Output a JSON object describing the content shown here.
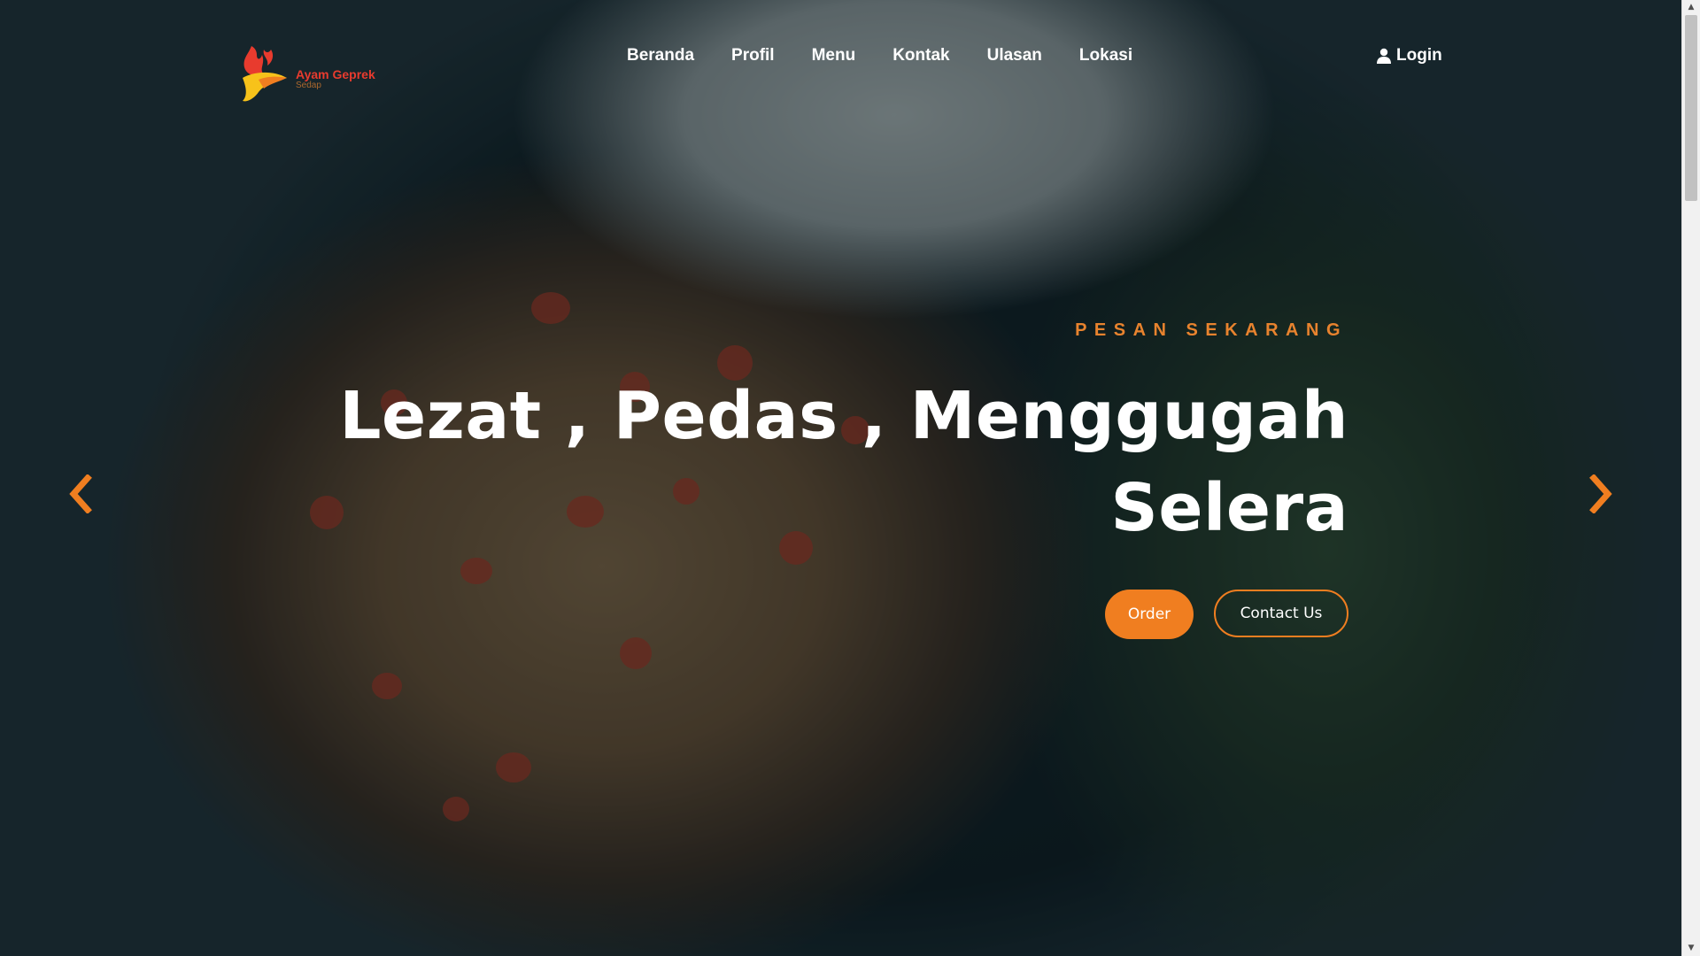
{
  "brand": {
    "name": "Ayam Geprek",
    "tagline": "Sedap",
    "logo_icon": "rooster-flame-logo",
    "colors": {
      "primary": "#f07e20",
      "red": "#e83b2e",
      "yellow": "#f7c21a"
    }
  },
  "nav": {
    "items": [
      {
        "label": "Beranda"
      },
      {
        "label": "Profil"
      },
      {
        "label": "Menu"
      },
      {
        "label": "Kontak"
      },
      {
        "label": "Ulasan"
      },
      {
        "label": "Lokasi"
      }
    ],
    "login_label": "Login",
    "login_icon": "user-icon"
  },
  "hero": {
    "eyebrow": "PESAN SEKARANG",
    "headline_line1": "Lezat , Pedas , Menggugah",
    "headline_line2": "Selera",
    "order_label": "Order",
    "contact_label": "Contact Us",
    "prev_icon": "chevron-left-icon",
    "next_icon": "chevron-right-icon"
  }
}
